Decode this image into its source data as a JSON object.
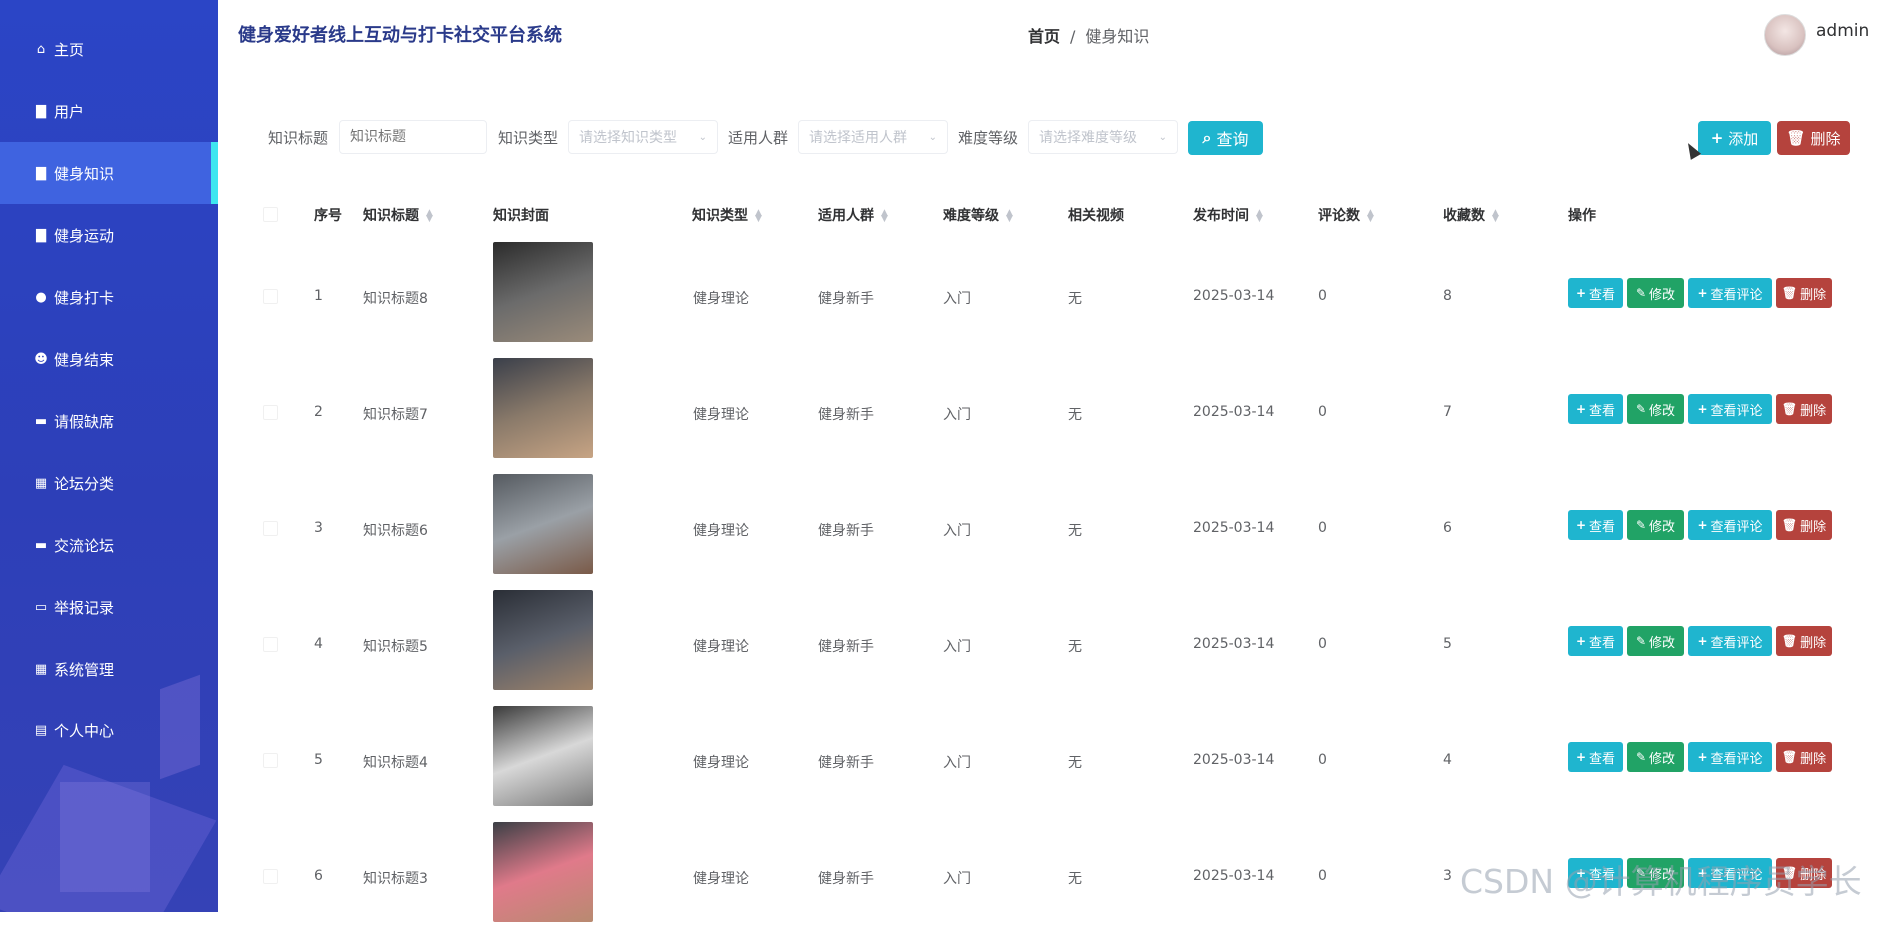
{
  "app": {
    "title": "健身爱好者线上互动与打卡社交平台系统"
  },
  "breadcrumb": {
    "home": "首页",
    "separator": "/",
    "current": "健身知识"
  },
  "user": {
    "name": "admin"
  },
  "sidebar": {
    "items": [
      {
        "label": "主页",
        "icon": "home-icon"
      },
      {
        "label": "用户",
        "icon": "clipboard-icon"
      },
      {
        "label": "健身知识",
        "icon": "clipboard-check-icon",
        "active": true
      },
      {
        "label": "健身运动",
        "icon": "clipboard-icon"
      },
      {
        "label": "健身打卡",
        "icon": "lightbulb-icon"
      },
      {
        "label": "健身结束",
        "icon": "person-icon"
      },
      {
        "label": "请假缺席",
        "icon": "flag-icon"
      },
      {
        "label": "论坛分类",
        "icon": "grid-icon"
      },
      {
        "label": "交流论坛",
        "icon": "ticket-icon"
      },
      {
        "label": "举报记录",
        "icon": "monitor-icon"
      },
      {
        "label": "系统管理",
        "icon": "grid-icon"
      },
      {
        "label": "个人中心",
        "icon": "card-icon"
      }
    ]
  },
  "search": {
    "title_label": "知识标题",
    "title_placeholder": "知识标题",
    "type_label": "知识类型",
    "type_placeholder": "请选择知识类型",
    "crowd_label": "适用人群",
    "crowd_placeholder": "请选择适用人群",
    "level_label": "难度等级",
    "level_placeholder": "请选择难度等级",
    "query_button": "查询",
    "add_button": "添加",
    "delete_button": "删除"
  },
  "table": {
    "headers": {
      "index": "序号",
      "title": "知识标题",
      "cover": "知识封面",
      "type": "知识类型",
      "crowd": "适用人群",
      "level": "难度等级",
      "video": "相关视频",
      "date": "发布时间",
      "comments": "评论数",
      "favorites": "收藏数",
      "actions": "操作"
    },
    "rows": [
      {
        "index": "1",
        "title": "知识标题8",
        "type": "健身理论",
        "crowd": "健身新手",
        "level": "入门",
        "video": "无",
        "date": "2025-03-14",
        "comments": "0",
        "favorites": "8"
      },
      {
        "index": "2",
        "title": "知识标题7",
        "type": "健身理论",
        "crowd": "健身新手",
        "level": "入门",
        "video": "无",
        "date": "2025-03-14",
        "comments": "0",
        "favorites": "7"
      },
      {
        "index": "3",
        "title": "知识标题6",
        "type": "健身理论",
        "crowd": "健身新手",
        "level": "入门",
        "video": "无",
        "date": "2025-03-14",
        "comments": "0",
        "favorites": "6"
      },
      {
        "index": "4",
        "title": "知识标题5",
        "type": "健身理论",
        "crowd": "健身新手",
        "level": "入门",
        "video": "无",
        "date": "2025-03-14",
        "comments": "0",
        "favorites": "5"
      },
      {
        "index": "5",
        "title": "知识标题4",
        "type": "健身理论",
        "crowd": "健身新手",
        "level": "入门",
        "video": "无",
        "date": "2025-03-14",
        "comments": "0",
        "favorites": "4"
      },
      {
        "index": "6",
        "title": "知识标题3",
        "type": "健身理论",
        "crowd": "健身新手",
        "level": "入门",
        "video": "无",
        "date": "2025-03-14",
        "comments": "0",
        "favorites": "3"
      }
    ],
    "row_actions": {
      "view": "查看",
      "edit": "修改",
      "view_comments": "查看评论",
      "delete": "删除"
    }
  },
  "watermark": "CSDN @计算机程序员学长",
  "colors": {
    "sidebar": "#2b45c6",
    "accent": "#1fb5cf",
    "success": "#21a366",
    "danger": "#b5433d",
    "active_indicator": "#3ee6f0"
  }
}
